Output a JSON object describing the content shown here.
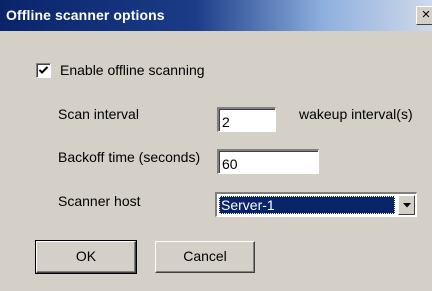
{
  "window": {
    "title": "Offline scanner options",
    "close_glyph": "×",
    "colors": {
      "title_bar": "#0a246a",
      "face": "#d4d0c8",
      "selection": "#0a246a"
    }
  },
  "enable_offline": {
    "label": "Enable offline scanning",
    "checked": true
  },
  "scan_interval": {
    "label": "Scan interval",
    "value": "2",
    "unit": "wakeup interval(s)"
  },
  "backoff": {
    "label": "Backoff time (seconds)",
    "value": "60"
  },
  "scanner_host": {
    "label": "Scanner host",
    "selected": "Server-1"
  },
  "buttons": {
    "ok": "OK",
    "cancel": "Cancel"
  }
}
